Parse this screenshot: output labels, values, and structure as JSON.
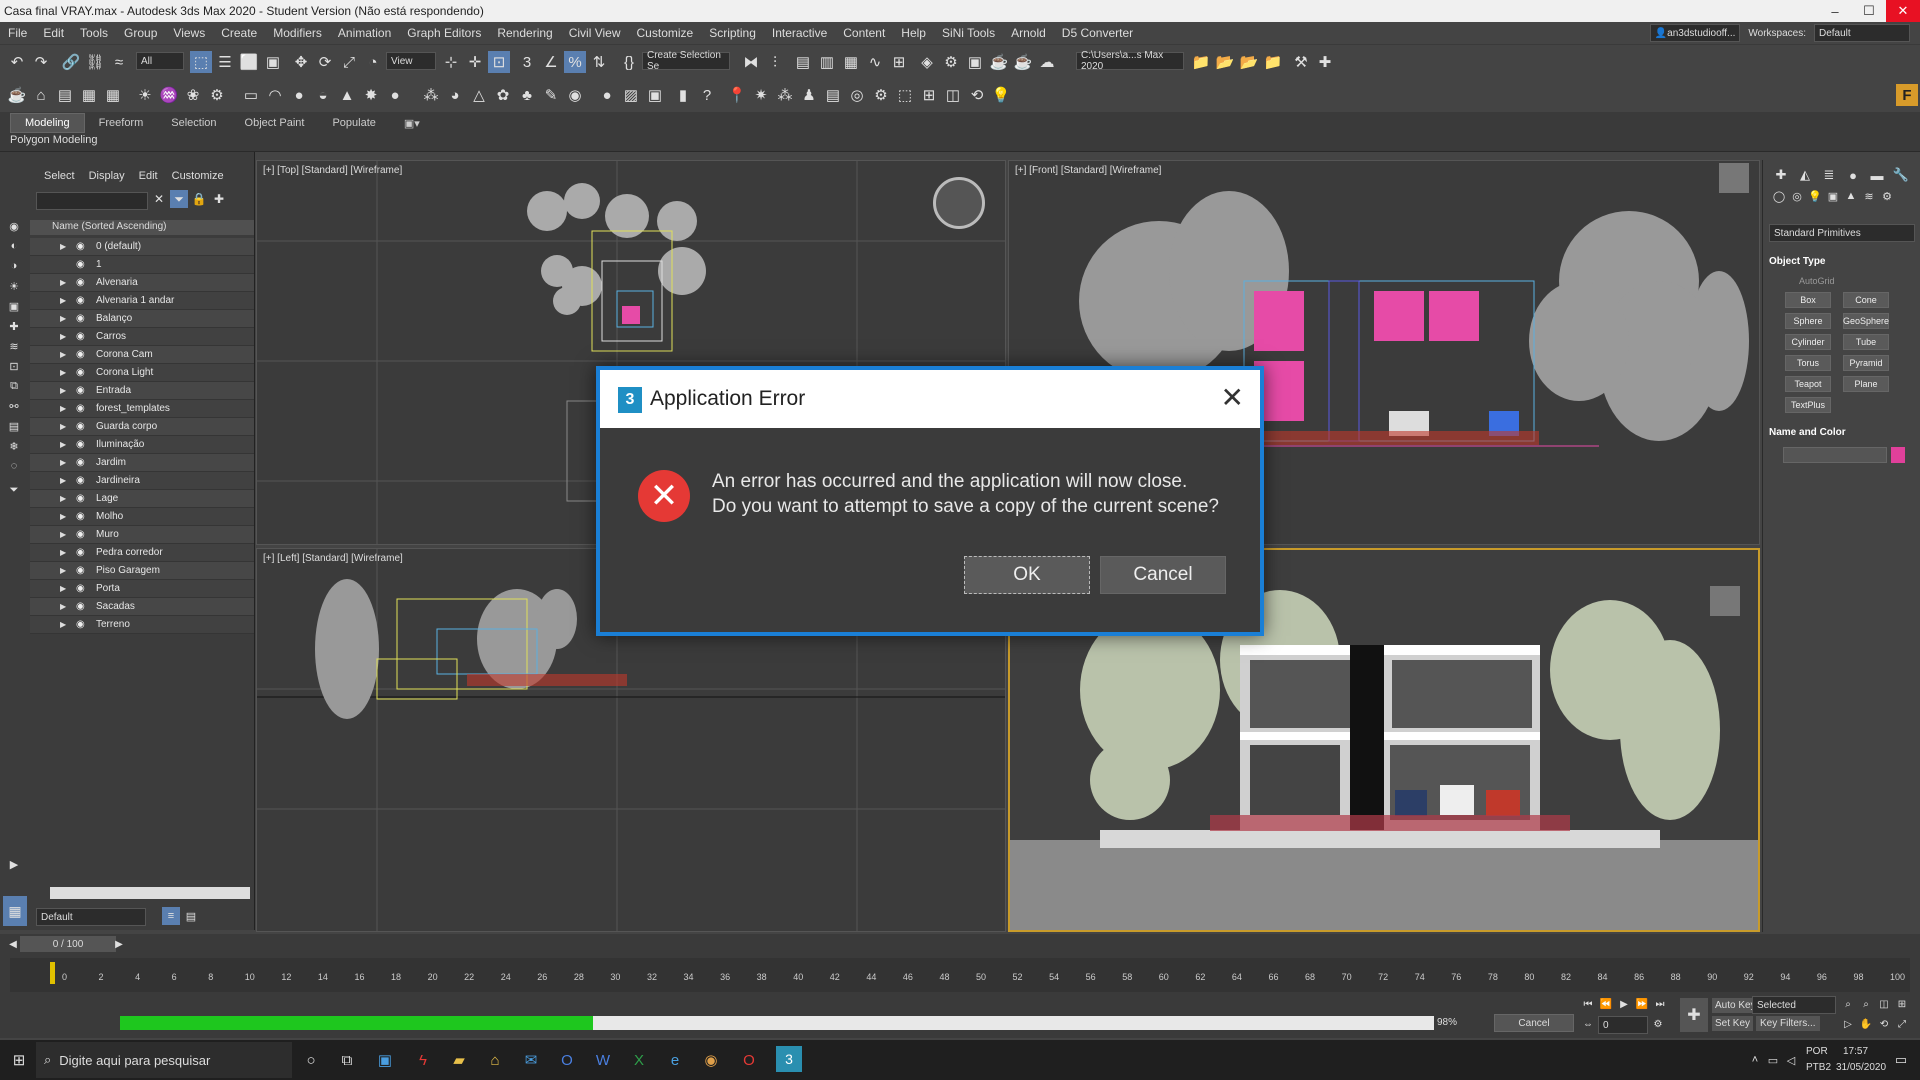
{
  "window": {
    "title": "Casa final VRAY.max - Autodesk 3ds Max 2020 - Student Version (Não está respondendo)"
  },
  "menu": [
    "File",
    "Edit",
    "Tools",
    "Group",
    "Views",
    "Create",
    "Modifiers",
    "Animation",
    "Graph Editors",
    "Rendering",
    "Civil View",
    "Customize",
    "Scripting",
    "Interactive",
    "Content",
    "Help",
    "SiNi Tools",
    "Arnold",
    "D5 Converter"
  ],
  "account": {
    "user": "an3dstudiooff...",
    "workspaces_label": "Workspaces:",
    "workspace": "Default"
  },
  "toolbar": {
    "selection_filter": "All",
    "ref_coord": "View",
    "selection_set": "Create Selection Se",
    "project_path": "C:\\Users\\a...s Max 2020"
  },
  "ribbon": {
    "tabs": [
      "Modeling",
      "Freeform",
      "Selection",
      "Object Paint",
      "Populate"
    ],
    "active": "Modeling",
    "sub": "Polygon Modeling"
  },
  "scene_explorer": {
    "menu": [
      "Select",
      "Display",
      "Edit",
      "Customize"
    ],
    "header": "Name (Sorted Ascending)",
    "layers": [
      "0 (default)",
      "1",
      "Alvenaria",
      "Alvenaria 1 andar",
      "Balanço",
      "Carros",
      "Corona Cam",
      "Corona Light",
      "Entrada",
      "forest_templates",
      "Guarda corpo",
      "Iluminação",
      "Jardim",
      "Jardineira",
      "Lage",
      "Molho",
      "Muro",
      "Pedra corredor",
      "Piso Garagem",
      "Porta",
      "Sacadas",
      "Terreno"
    ],
    "layer_dropdown": "Default"
  },
  "viewports": {
    "top": "[+] [Top] [Standard] [Wireframe]",
    "front": "[+] [Front] [Standard] [Wireframe]",
    "left": "[+] [Left] [Standard] [Wireframe]"
  },
  "command_panel": {
    "category": "Standard Primitives",
    "object_type_title": "Object Type",
    "autogrid": "AutoGrid",
    "buttons": [
      "Box",
      "Cone",
      "Sphere",
      "GeoSphere",
      "Cylinder",
      "Tube",
      "Torus",
      "Pyramid",
      "Teapot",
      "Plane",
      "TextPlus"
    ],
    "name_color_title": "Name and Color",
    "object_color": "#e0409a"
  },
  "timeline": {
    "frame_display": "0 / 100",
    "ticks": [
      "0",
      "2",
      "4",
      "6",
      "8",
      "10",
      "12",
      "14",
      "16",
      "18",
      "20",
      "22",
      "24",
      "26",
      "28",
      "30",
      "32",
      "34",
      "36",
      "38",
      "40",
      "42",
      "44",
      "46",
      "48",
      "50",
      "52",
      "54",
      "56",
      "58",
      "60",
      "62",
      "64",
      "66",
      "68",
      "70",
      "72",
      "74",
      "76",
      "78",
      "80",
      "82",
      "84",
      "86",
      "88",
      "90",
      "92",
      "94",
      "96",
      "98",
      "100"
    ]
  },
  "status": {
    "progress": 0.36,
    "progress_text": "98%",
    "cancel": "Cancel",
    "auto_key": "Auto Key",
    "set_key": "Set Key",
    "selected": "Selected",
    "key_filters": "Key Filters...",
    "frame": "0"
  },
  "dialog": {
    "title": "Application Error",
    "line1": "An error has occurred and the application will now close.",
    "line2": "Do you want to attempt to save a copy of the current scene?",
    "ok": "OK",
    "cancel": "Cancel"
  },
  "taskbar": {
    "search_placeholder": "Digite aqui para pesquisar",
    "lang1": "POR",
    "lang2": "PTB2",
    "time": "17:57",
    "date": "31/05/2020"
  }
}
